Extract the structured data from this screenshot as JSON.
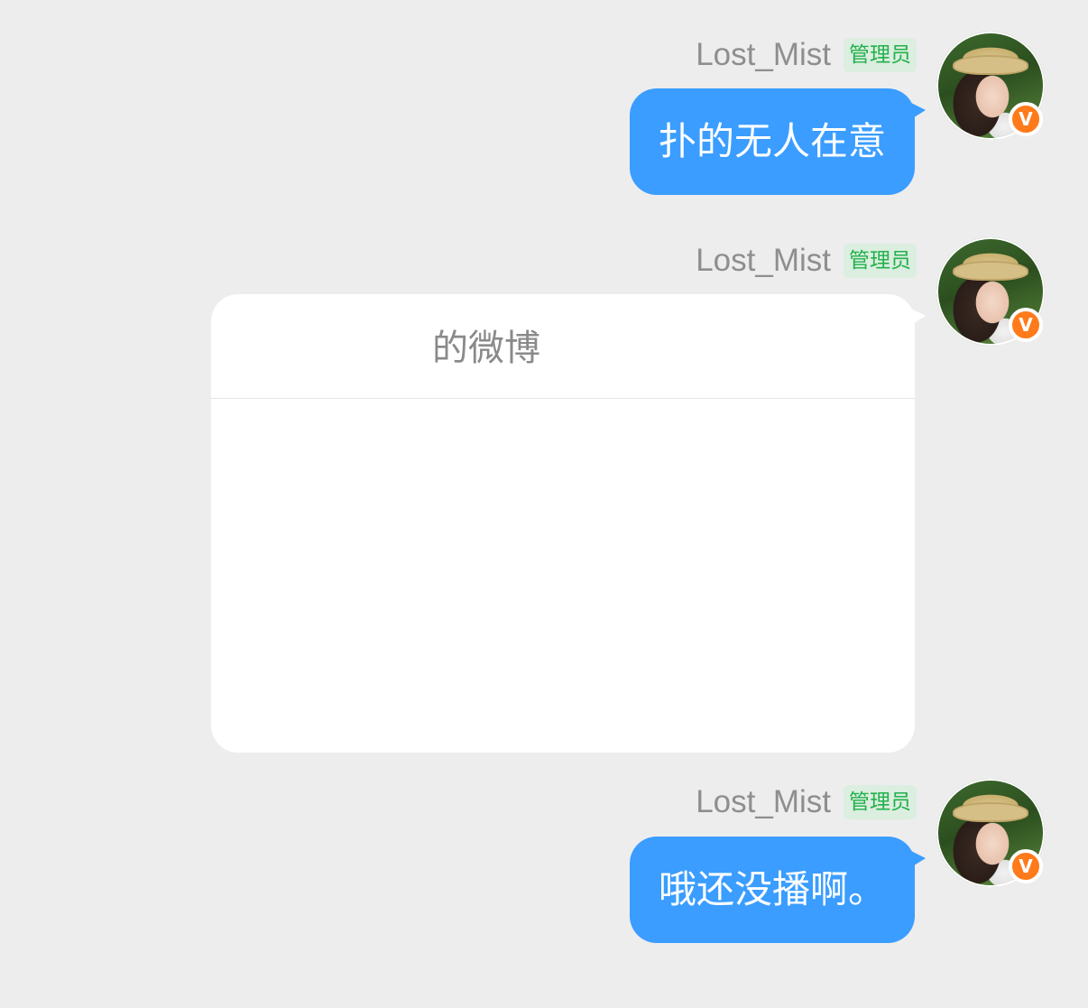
{
  "messages": [
    {
      "username": "Lost_Mist",
      "role": "管理员",
      "verified_badge": "V",
      "type": "text",
      "text": "扑的无人在意"
    },
    {
      "username": "Lost_Mist",
      "role": "管理员",
      "verified_badge": "V",
      "type": "card",
      "card_title": "的微博"
    },
    {
      "username": "Lost_Mist",
      "role": "管理员",
      "verified_badge": "V",
      "type": "text",
      "text": "哦还没播啊。"
    }
  ],
  "colors": {
    "background": "#ededed",
    "bubble": "#3a9dff",
    "role_badge_text": "#22b14c",
    "role_badge_bg": "#dbeedf",
    "verified_badge": "#ff7a1a"
  },
  "icons": {
    "avatar": "avatar-photo",
    "verified": "verified-v-badge-icon"
  }
}
